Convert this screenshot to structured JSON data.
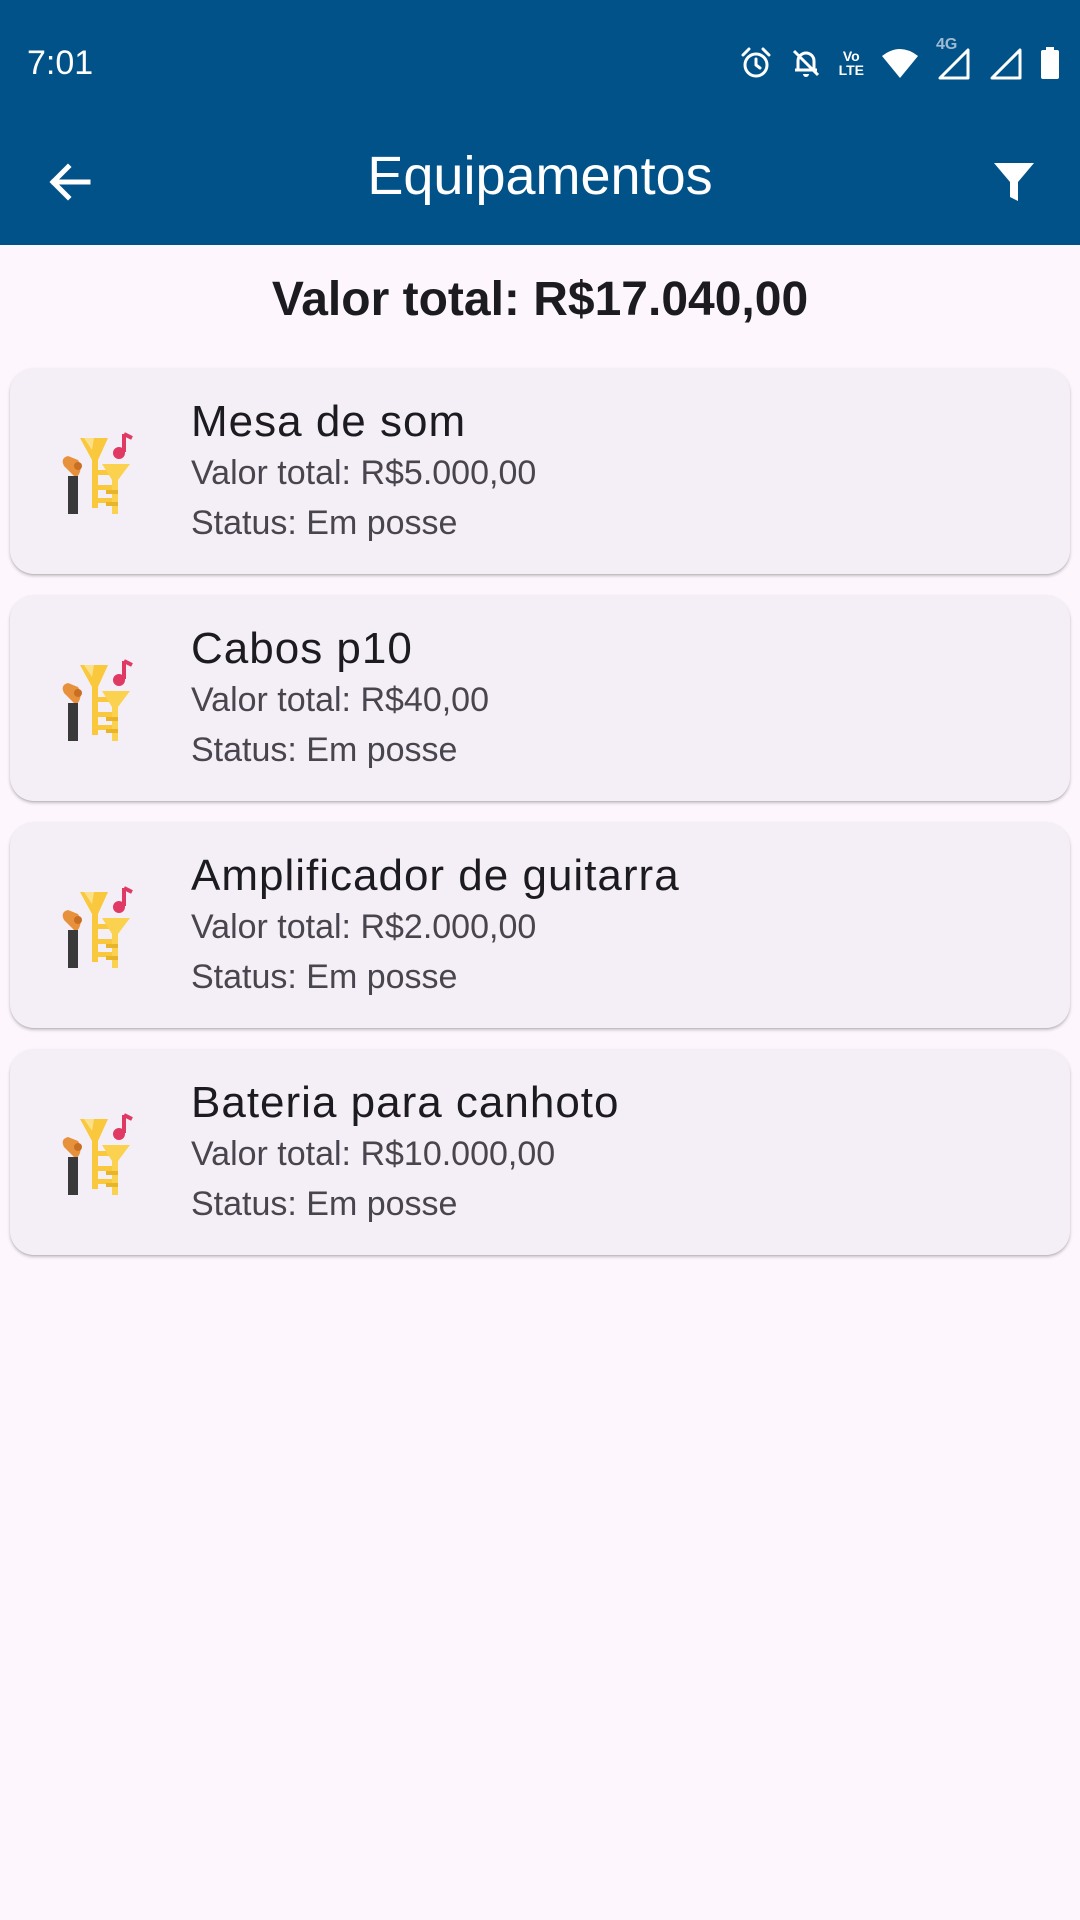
{
  "status_bar": {
    "time": "7:01",
    "icons": [
      "alarm-icon",
      "notifications-off-icon",
      "volte-icon",
      "wifi-icon",
      "signal-4g-icon",
      "signal-icon",
      "battery-icon"
    ],
    "network_label": "4G",
    "volte_label_top": "Vo",
    "volte_label_bottom": "LTE"
  },
  "app_bar": {
    "title": "Equipamentos",
    "back_icon": "arrow-back-icon",
    "filter_icon": "filter-icon",
    "color": "#02528a"
  },
  "summary": {
    "total_text": "Valor total: R$17.040,00"
  },
  "equipments": [
    {
      "name": "Mesa de som",
      "value": "Valor total: R$5.000,00",
      "status": "Status: Em posse",
      "icon": "musical-instruments-icon"
    },
    {
      "name": "Cabos p10",
      "value": "Valor total: R$40,00",
      "status": "Status: Em posse",
      "icon": "musical-instruments-icon"
    },
    {
      "name": "Amplificador de guitarra",
      "value": "Valor total: R$2.000,00",
      "status": "Status: Em posse",
      "icon": "musical-instruments-icon"
    },
    {
      "name": "Bateria para canhoto",
      "value": "Valor total: R$10.000,00",
      "status": "Status: Em posse",
      "icon": "musical-instruments-icon"
    }
  ],
  "colors": {
    "primary": "#02528a",
    "background": "#fdf7fd",
    "card": "#f4eff6",
    "text_primary": "#1c1b1f",
    "text_secondary": "#49454f"
  }
}
